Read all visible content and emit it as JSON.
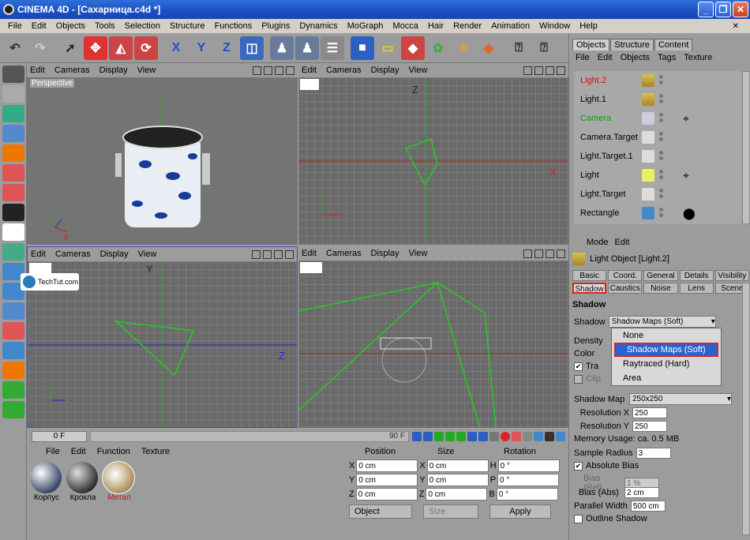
{
  "window": {
    "title": "CINEMA 4D - [Сахарница.c4d *]"
  },
  "menu": [
    "File",
    "Edit",
    "Objects",
    "Tools",
    "Selection",
    "Structure",
    "Functions",
    "Plugins",
    "Dynamics",
    "MoGraph",
    "Mocca",
    "Hair",
    "Render",
    "Animation",
    "Window",
    "Help"
  ],
  "viewports": {
    "menu": [
      "Edit",
      "Cameras",
      "Display",
      "View"
    ],
    "perspective_label": "Perspective",
    "axis_x": "X",
    "axis_y": "Y",
    "axis_z": "Z"
  },
  "watermark": "TechTut.com",
  "timeline": {
    "current_frame": "0 F",
    "end_frame": "90 F"
  },
  "materials": {
    "menu": [
      "File",
      "Edit",
      "Function",
      "Texture"
    ],
    "items": [
      {
        "name": "Корпус",
        "selected": false
      },
      {
        "name": "Крокла",
        "selected": false
      },
      {
        "name": "Метал",
        "selected": true
      }
    ]
  },
  "coords": {
    "headers": [
      "Position",
      "Size",
      "Rotation"
    ],
    "rows": [
      {
        "a": "X",
        "pos": "0 cm",
        "b": "X",
        "size": "0 cm",
        "c": "H",
        "rot": "0 °"
      },
      {
        "a": "Y",
        "pos": "0 cm",
        "b": "Y",
        "size": "0 cm",
        "c": "P",
        "rot": "0 °"
      },
      {
        "a": "Z",
        "pos": "0 cm",
        "b": "Z",
        "size": "0 cm",
        "c": "B",
        "rot": "0 °"
      }
    ],
    "mode": "Object",
    "size_mode": "Size",
    "apply": "Apply"
  },
  "objects_panel": {
    "tabs": [
      "Objects",
      "Structure",
      "Content"
    ],
    "menu": [
      "File",
      "Edit",
      "Objects",
      "Tags",
      "Texture"
    ],
    "items": [
      {
        "name": "Light.2",
        "color": "#d01010"
      },
      {
        "name": "Light.1",
        "color": "#000000"
      },
      {
        "name": "Camera",
        "color": "#10a010"
      },
      {
        "name": "Camera.Target",
        "color": "#000000"
      },
      {
        "name": "Light.Target.1",
        "color": "#000000"
      },
      {
        "name": "Light",
        "color": "#000000"
      },
      {
        "name": "Light.Target",
        "color": "#000000"
      },
      {
        "name": "Rectangle",
        "color": "#000000"
      }
    ]
  },
  "attributes": {
    "menu": [
      "Mode",
      "Edit"
    ],
    "title": "Light Object [Light.2]",
    "tabs": [
      "Basic",
      "Coord.",
      "General",
      "Details",
      "Visibility",
      "Shadow",
      "Caustics",
      "Noise",
      "Lens",
      "Scene"
    ],
    "section": "Shadow",
    "shadow_label": "Shadow",
    "shadow_value": "Shadow Maps (Soft)",
    "dropdown_options": [
      "None",
      "Shadow Maps (Soft)",
      "Raytraced (Hard)",
      "Area"
    ],
    "density_label": "Density",
    "color_label": "Color",
    "transparency_label": "Tra",
    "clip_label": "Clip",
    "shadow_map_label": "Shadow Map",
    "shadow_map_value": "250x250",
    "res_x_label": "Resolution X",
    "res_x": "250",
    "res_y_label": "Resolution Y",
    "res_y": "250",
    "memory": "Memory Usage: ca. 0.5 MB",
    "sample_radius_label": "Sample Radius",
    "sample_radius": "3",
    "absolute_bias": "Absolute Bias",
    "bias_rel_label": "Bias (Rel)",
    "bias_rel": "1 %",
    "bias_abs_label": "Bias (Abs)",
    "bias_abs": "2 cm",
    "parallel_width_label": "Parallel Width",
    "parallel_width": "500 cm",
    "outline_shadow": "Outline Shadow"
  }
}
